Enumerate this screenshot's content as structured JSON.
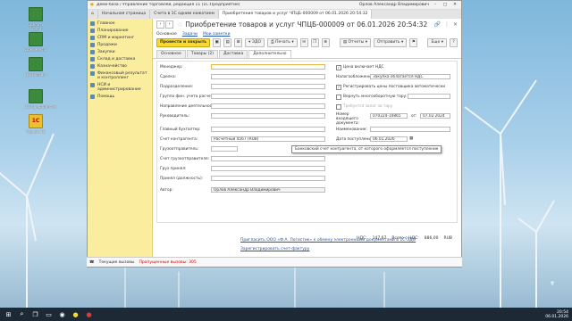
{
  "window": {
    "title": "Демо-база / Управление торговлей, редакция 11  (1С:Предприятие)",
    "user": "Орлов Александр Владимирович"
  },
  "open_tabs": [
    {
      "label": "Начальная страница"
    },
    {
      "label": "Счета в 1С одним нажатием"
    },
    {
      "label": "Приобретение товаров и услуг ЧПЦБ-000009 от 06.01.2026 20:54:32"
    }
  ],
  "sidebar": {
    "items": [
      {
        "label": "Главное"
      },
      {
        "label": "Планирование"
      },
      {
        "label": "CRM и маркетинг"
      },
      {
        "label": "Продажи"
      },
      {
        "label": "Закупки"
      },
      {
        "label": "Склад и доставка"
      },
      {
        "label": "Казначейство"
      },
      {
        "label": "Финансовый результат и контроллинг"
      },
      {
        "label": "НСИ и администрирование"
      },
      {
        "label": "Помощь"
      }
    ]
  },
  "doc": {
    "title": "Приобретение товаров и услуг ЧПЦБ-000009 от 06.01.2026 20:54:32",
    "links": {
      "main": "Основное",
      "tasks": "Задачи",
      "my_notes": "Мои заметки"
    },
    "toolbar": {
      "post_close": "Провести и закрыть",
      "edo": "ЭДО",
      "print": "Печать",
      "reports": "Отчеты",
      "send": "Отправить",
      "more": "Еще"
    },
    "tabs": [
      "Основное",
      "Товары (2)",
      "Доставка",
      "Дополнительно"
    ],
    "left_labels": [
      "Менеджер:",
      "Сделка:",
      "Подразделение:",
      "Группа фин. учета расчетов:",
      "Направление деятельности:",
      "Руководитель:",
      "Главный бухгалтер:",
      "Счет контрагента:",
      "Грузоотправитель:",
      "Счет грузоотправителя:",
      "Груз принял:",
      "Принял (должность):",
      "Автор:"
    ],
    "bank_account": "Расчетный 4567 (RUB)",
    "author": "Орлов Александр Владимирович",
    "right": {
      "price_vat": "Цена включает НДС",
      "taxation_label": "Налогообложение:",
      "taxation_value": "Закупка облагается НДС",
      "register_prices": "Регистрировать цены поставщика автоматически",
      "return_tara": "Вернуть многооборотную тару:",
      "separate_tara": "Требуется залог за тару",
      "incoming_number_label": "Номер входящего документа:",
      "incoming_number": "070224-10865",
      "from_label": "от:",
      "incoming_date": "07.02.2024",
      "naming_label": "Наименование:",
      "received_label": "Дата поступления:",
      "received_date": "06.01.2026"
    },
    "tooltip": "Банковский счет контрагента, от которого оформляется поступление",
    "footer": {
      "link1": "Пригласить ООО «Ф.А. Логистик» к обмену электронными документами в 1С-ЭДО",
      "link2": "Зарегистрировать счет-фактуру"
    },
    "totals": {
      "vat_label": "НДС:",
      "vat_value": "147,67",
      "total_label": "Всего с НДС:",
      "total_value": "886,00",
      "currency": "RUB"
    }
  },
  "statusbar": {
    "current_calls": "Текущие вызовы",
    "missed_calls": "Пропущенные вызовы: 305"
  },
  "desktop": {
    "icons": [
      {
        "label": "Сделать 1С в 4 клика"
      },
      {
        "label": "Документы"
      },
      {
        "label": "1С Плагин"
      },
      {
        "label": "1С:Предприятие"
      },
      {
        "label": "Сервис 1С"
      }
    ]
  },
  "clock": {
    "time": "20:54",
    "date": "06.01.2026"
  }
}
